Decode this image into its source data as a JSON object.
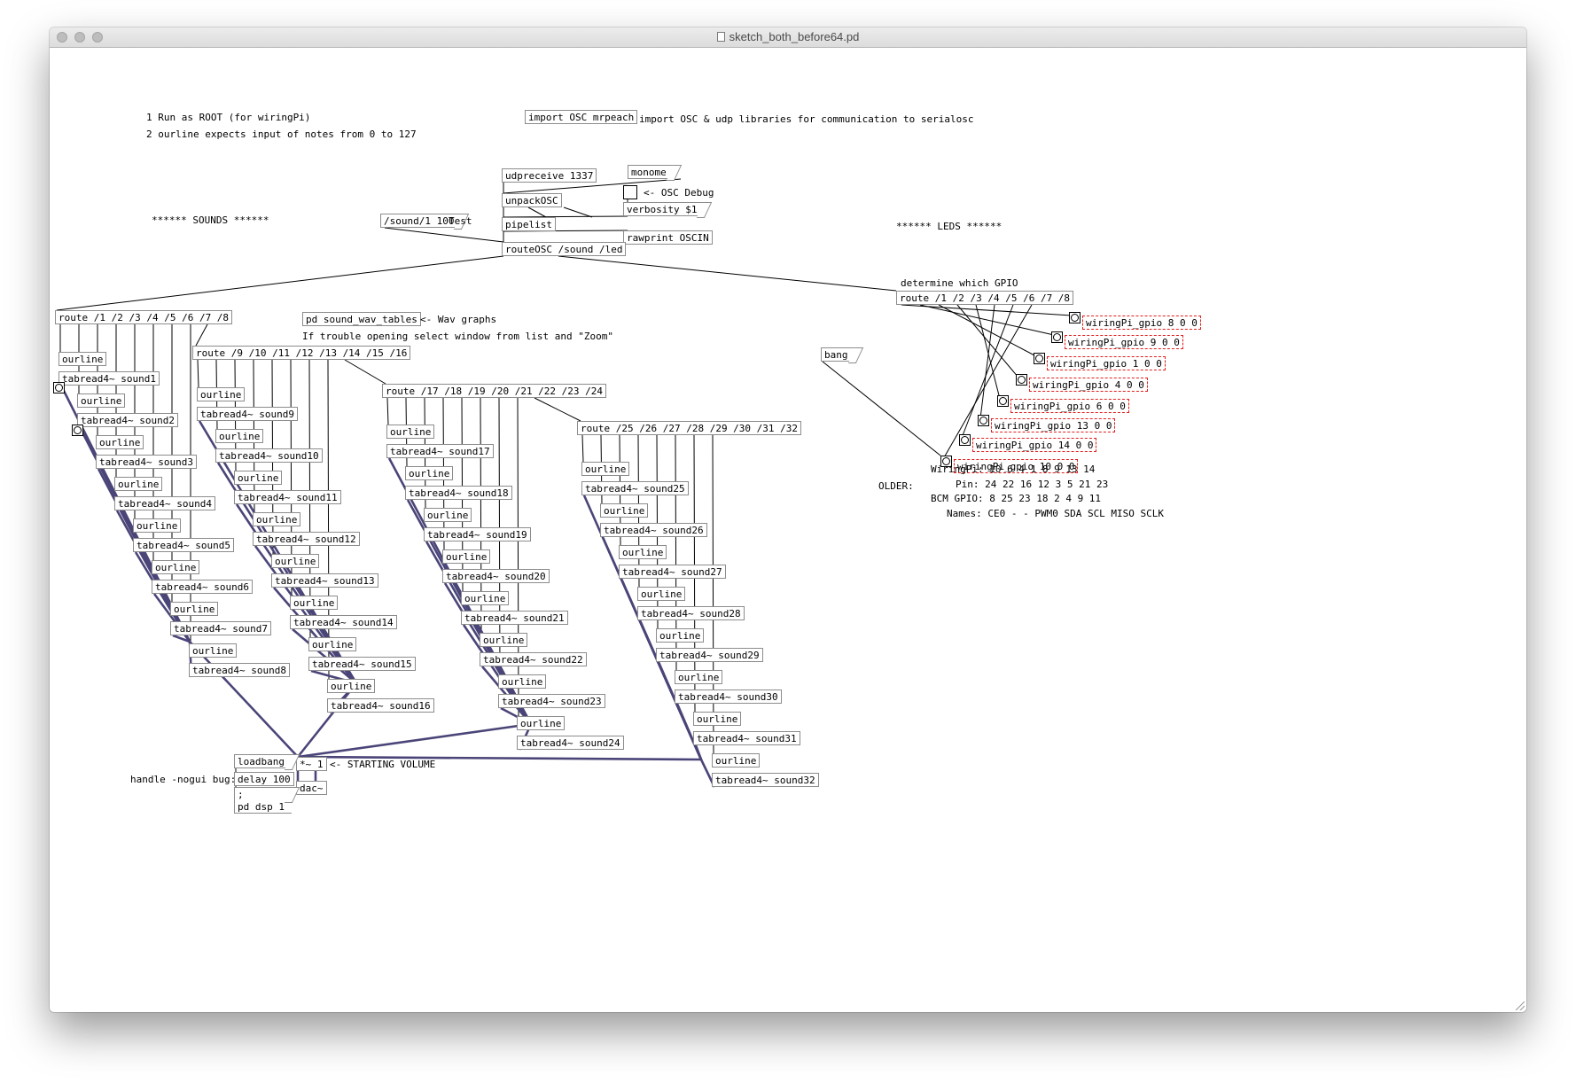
{
  "window": {
    "title": "sketch_both_before64.pd"
  },
  "header": {
    "comment_root": "1 Run as ROOT (for wiringPi)",
    "comment_ourline": "2 ourline expects input of notes from 0 to 127",
    "import_obj": "import OSC mrpeach",
    "import_comment": "import OSC & udp libraries for communication to serialosc"
  },
  "osc": {
    "udpreceive": "udpreceive 1337",
    "monome": "monome",
    "debug_comment": "<- OSC Debug",
    "unpack": "unpackOSC",
    "verbosity": "verbosity $1",
    "pipelist": "pipelist",
    "rawprint": "rawprint OSCIN",
    "test_msg": "/sound/1 100",
    "test_label": "Test",
    "router": "routeOSC /sound /led"
  },
  "sounds": {
    "header": "****** SOUNDS ******",
    "routes": [
      "route /1 /2 /3 /4 /5 /6 /7 /8",
      "route /9 /10 /11 /12 /13 /14 /15 /16",
      "route /17 /18 /19 /20 /21 /22 /23 /24",
      "route /25 /26 /27 /28 /29 /30 /31 /32"
    ],
    "ourline_label": "ourline",
    "tabreads": [
      "tabread4~ sound1",
      "tabread4~ sound2",
      "tabread4~ sound3",
      "tabread4~ sound4",
      "tabread4~ sound5",
      "tabread4~ sound6",
      "tabread4~ sound7",
      "tabread4~ sound8",
      "tabread4~ sound9",
      "tabread4~ sound10",
      "tabread4~ sound11",
      "tabread4~ sound12",
      "tabread4~ sound13",
      "tabread4~ sound14",
      "tabread4~ sound15",
      "tabread4~ sound16",
      "tabread4~ sound17",
      "tabread4~ sound18",
      "tabread4~ sound19",
      "tabread4~ sound20",
      "tabread4~ sound21",
      "tabread4~ sound22",
      "tabread4~ sound23",
      "tabread4~ sound24",
      "tabread4~ sound25",
      "tabread4~ sound26",
      "tabread4~ sound27",
      "tabread4~ sound28",
      "tabread4~ sound29",
      "tabread4~ sound30",
      "tabread4~ sound31",
      "tabread4~ sound32"
    ],
    "wav_tables": "pd sound_wav_tables",
    "wav_comment": "<- Wav graphs",
    "trouble_comment": "If trouble opening select window from list and \"Zoom\""
  },
  "output": {
    "multiply": "*~ 1",
    "volume_comment": "<- STARTING VOLUME",
    "dac": "dac~",
    "loadbang": "loadbang",
    "delay": "delay 100",
    "semicolon": ";",
    "dsp": "pd dsp 1",
    "nogui_comment": "handle -nogui bug:"
  },
  "leds": {
    "header": "****** LEDS ******",
    "determine_comment": "determine which GPIO",
    "route": "route /1 /2 /3 /4 /5 /6 /7 /8",
    "bang": "bang",
    "gpio": [
      "wiringPi_gpio 8 0 0",
      "wiringPi_gpio 9 0 0",
      "wiringPi_gpio 1 0 0",
      "wiringPi_gpio 4 0 0",
      "wiringPi_gpio 6 0 0",
      "wiringPi_gpio 13 0 0",
      "wiringPi_gpio 14 0 0",
      "wiringPi_gpio 10 0 0"
    ],
    "pin_table": {
      "wiringpi": "WiringPi: 10 6 4 1 8 9 13 14",
      "older": "OLDER:",
      "pin": "Pin: 24 22 16 12 3 5 21 23",
      "bcm": "BCM GPIO: 8 25 23 18 2 4 9 11",
      "names": "Names: CE0 - - PWM0 SDA SCL MISO SCLK"
    }
  },
  "colors": {
    "signal_cord": "#4a4578",
    "broken_object_border": "#e0201e"
  }
}
